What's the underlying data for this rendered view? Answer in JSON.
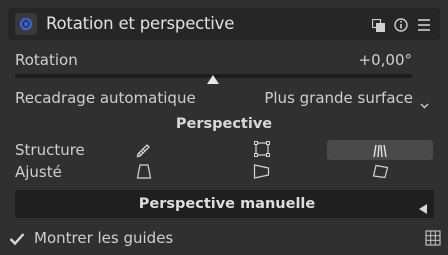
{
  "header": {
    "title": "Rotation et perspective",
    "icons": [
      "module-icon",
      "presets-icon",
      "reset-icon",
      "menu-icon"
    ]
  },
  "rotation": {
    "label": "Rotation",
    "value": "+0,00°"
  },
  "autocrop": {
    "label": "Recadrage automatique",
    "value": "Plus grande surface"
  },
  "perspective": {
    "title": "Perspective",
    "structure_label": "Structure",
    "adjusted_label": "Ajusté",
    "structure_tools": [
      "pencil-icon",
      "rectangle-icon",
      "lines-icon"
    ],
    "adjusted_tools": [
      "vertical-trapezoid-icon",
      "horizontal-trapezoid-icon",
      "full-trapezoid-icon"
    ]
  },
  "manual": {
    "label": "Perspective manuelle"
  },
  "guides": {
    "label": "Montrer les guides",
    "checked": true
  },
  "colors": {
    "accent": "#3e64c8",
    "background": "#303030"
  }
}
